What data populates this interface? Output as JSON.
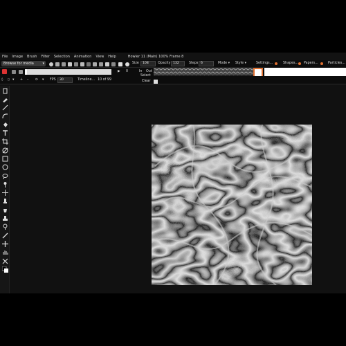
{
  "menu": [
    "File",
    "Image",
    "Brush",
    "Filter",
    "Selection",
    "Animation",
    "View",
    "Help"
  ],
  "title": "Howler 11 (Main)  100%  Frame 8",
  "toolbar": {
    "browse_label": "Browse for media",
    "size_label": "Size",
    "size_value": "108",
    "opacity_label": "Opacity",
    "opacity_value": "132",
    "steps_label": "Steps",
    "steps_value": "6",
    "mode_label": "Mode",
    "style_label": "Style",
    "settings_label": "Settings...",
    "shapes_label": "Shapes...",
    "papers_label": "Papers...",
    "particles_label": "Particles...",
    "in_label": "In",
    "out_label": "Out",
    "select_label": "Select",
    "clear_label": "Clear"
  },
  "animation": {
    "frame_count": "0",
    "fps_label": "FPS",
    "fps_value": "30",
    "timeline_label": "Timeline...",
    "frame_status": "10 of 99",
    "progress": 0.02
  },
  "colors": {
    "background": "#111111",
    "toolbar": "#0c0c0c",
    "accent": "#e07030",
    "canvas": "#222222"
  },
  "tools": [
    "select-tool-icon",
    "eyedropper-icon",
    "line-icon",
    "curve-icon",
    "fill-icon",
    "text-icon",
    "crop-icon",
    "erase-icon",
    "rectangle-icon",
    "ellipse-icon",
    "lasso-icon",
    "pin-icon",
    "move-icon",
    "smudge-icon",
    "bucket-icon",
    "stamp-icon",
    "pen-icon",
    "brush-icon",
    "cross-icon",
    "hand-icon",
    "scissors-icon",
    "color-swatch-icon"
  ]
}
